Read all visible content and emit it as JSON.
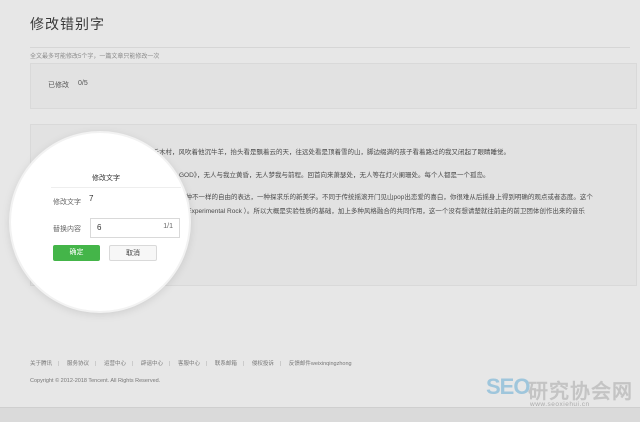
{
  "page": {
    "title": "修改错别字",
    "subnote": "全文最多可能修改5个字，一篇文章只能修改一次"
  },
  "status": {
    "label": "已修改",
    "count": "0/5"
  },
  "article": {
    "lines": [
      "图片摄于12年10月份的北疆禾木村，风吹着他沉牛羊，抬头看是飘着云的天，往远处看是顶着雪的山，脚边缀满的孩子看着路过的我又闭起了眼睛睡觉。",
      "GOD》，无人与我立黄昏，无人梦我与前程。回首向来萧瑟处，无人等在灯火阑珊处。每个人都是一个孤岛。",
      "一种不一样的自由的表达，一种探求乐的新美学。不同于传统摇滚开门见山pop出恋爱的喜白，你很难从后摇身上得到明确的观点或者态度。这个",
      "（ Experimental Rock ）。所以大概是实验性质的基础，加上多种风格融合的共同作用，这一个没有想请楚就往前走的前卫团体创作出来的音乐"
    ]
  },
  "dialog": {
    "title": "修改文字",
    "field1_label": "修改文字",
    "field1_value": "7",
    "field2_label": "替换内容",
    "field2_value": "6",
    "field2_count": "1/1",
    "confirm_label": "确定",
    "cancel_label": "取消"
  },
  "footer": {
    "links": [
      "关于腾讯",
      "服务协议",
      "运营中心",
      "辟谣中心",
      "客服中心",
      "联系邮箱",
      "侵权投诉",
      "反馈邮件weixinqingzhong"
    ],
    "copyright": "Copyright © 2012-2018 Tencent. All Rights Reserved."
  },
  "watermark": {
    "brand": "SEO",
    "brand_cn": "研究协会网",
    "url": "www.seoxiehui.cn"
  }
}
